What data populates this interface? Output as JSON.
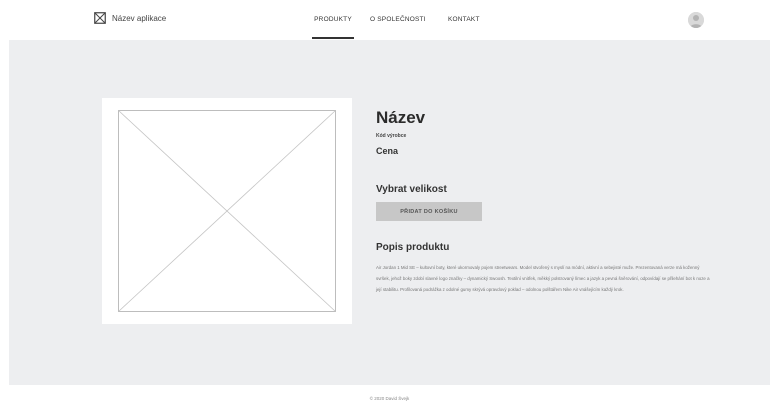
{
  "header": {
    "brand": {
      "icon": "image-placeholder-icon",
      "name": "Název aplikace"
    },
    "nav": [
      {
        "label": "PRODUKTY",
        "active": true
      },
      {
        "label": "O SPOLEČNOSTI",
        "active": false
      },
      {
        "label": "KONTAKT",
        "active": false
      }
    ],
    "avatar_icon": "user-avatar-icon"
  },
  "product": {
    "image_icon": "image-placeholder-icon",
    "title": "Název",
    "code_label": "Kód výrobce",
    "price_label": "Cena",
    "size_heading": "Vybrat velikost",
    "add_to_cart_label": "PŘIDAT DO KOŠÍKU",
    "description_heading": "Popis produktu",
    "description": "Air Jordan 1 Mid SE – kultovní boty, které ukormovaly pojem streetwears. Model stvořený s myslí na módní, aktivní a sebejisté muže. Prezentovaná verze má koženný svršek, jehož boky zdobí slavné logo značky – dynamický Swoosh. Textilní vnitřek, měkký polstrovaný límec a jazyk a pevná šněrování, odpovídají se přilehání bot k noze a její stabilitu. Profilovaná podrážka z odolné gumy skrývá opravdový poklad – odolnou polštářem Nike Air vnášejícím každý krok."
  },
  "footer": {
    "text": "© 2020 David Švejk"
  },
  "colors": {
    "background": "#ffffff",
    "main_area": "#edeef0",
    "button": "#c7c7c7",
    "text_dark": "#2b2b2b",
    "text_muted": "#777777"
  }
}
